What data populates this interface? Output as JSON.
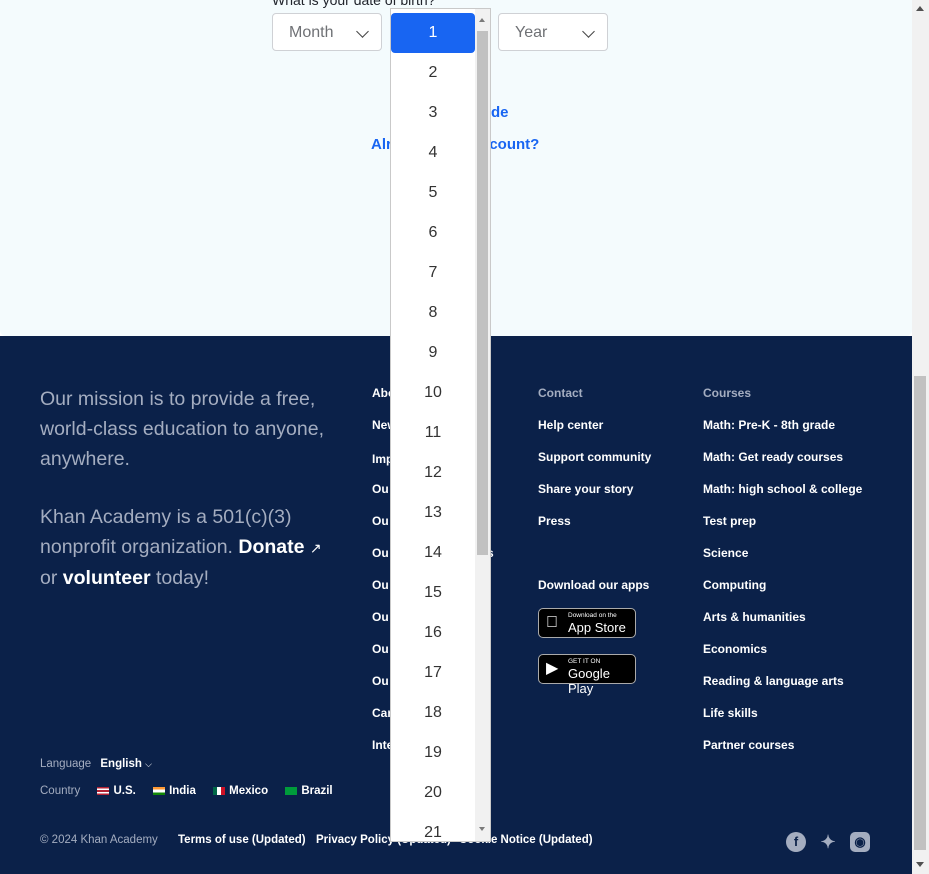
{
  "signup": {
    "dob_label": "What is your date of birth?",
    "month_placeholder": "Month",
    "day_selected": "1",
    "year_placeholder": "Year",
    "link_grade": "de",
    "link_account_left": "Alr",
    "link_account_right": "ccount?"
  },
  "day_options": [
    "1",
    "2",
    "3",
    "4",
    "5",
    "6",
    "7",
    "8",
    "9",
    "10",
    "11",
    "12",
    "13",
    "14",
    "15",
    "16",
    "17",
    "18",
    "19",
    "20",
    "21"
  ],
  "footer": {
    "mission_line": "Our mission is to provide a free, world-class education to anyone, anywhere.",
    "nonprofit_prefix": "Khan Academy is a 501(c)(3) nonprofit organization.",
    "donate": "Donate",
    "or": "or",
    "volunteer": "volunteer",
    "today": "today!",
    "about_partial": [
      "Abo",
      "New",
      "Imp",
      "Ou",
      "Ou",
      "Ou",
      "Ou",
      "Ou",
      "Ou",
      "Ou",
      "Car",
      "Inte"
    ],
    "about_tail": "s",
    "contact": {
      "heading": "Contact",
      "items": [
        "Help center",
        "Support community",
        "Share your story",
        "Press"
      ]
    },
    "apps_heading": "Download our apps",
    "app_store": {
      "small": "Download on the",
      "big": "App Store"
    },
    "google_play": {
      "small": "GET IT ON",
      "big": "Google Play"
    },
    "courses": {
      "heading": "Courses",
      "items": [
        "Math: Pre-K - 8th grade",
        "Math: Get ready courses",
        "Math: high school & college",
        "Test prep",
        "Science",
        "Computing",
        "Arts & humanities",
        "Economics",
        "Reading & language arts",
        "Life skills",
        "Partner courses"
      ]
    },
    "language_label": "Language",
    "language_value": "English",
    "country_label": "Country",
    "countries": [
      "U.S.",
      "India",
      "Mexico",
      "Brazil"
    ],
    "copyright": "© 2024 Khan Academy",
    "terms": "Terms of use (Updated)",
    "privacy_left": "Privacy Policy (",
    "privacy_right": "Updated)",
    "cookie_left": "C",
    "cookie_right": "ookie Notice (Updated)"
  },
  "colors": {
    "accent": "#1865f2",
    "footer_bg": "#0b2149"
  }
}
